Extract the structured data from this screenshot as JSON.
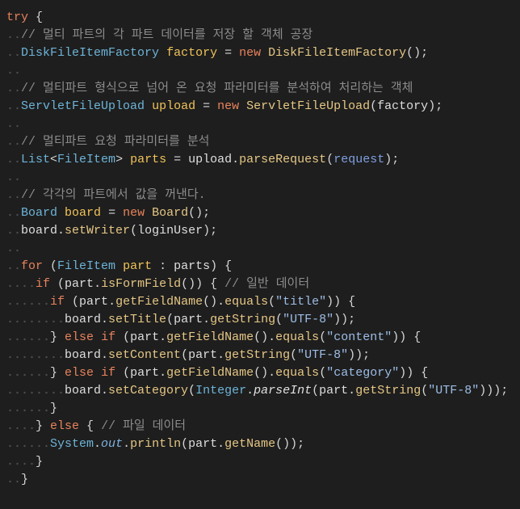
{
  "theme": {
    "background": "#1e1e1e",
    "punct": "#d6d6d6",
    "keyword": "#e8835c",
    "comment": "#8c8c8c",
    "type": "#6db4d8",
    "declaration": "#f0c35a",
    "method": "#e6c785",
    "string": "#9dbde6",
    "parameter": "#7f9fdf",
    "variable": "#dedede",
    "field": "#7fb3e0",
    "static_method": "#e0e0e0",
    "whitespace": "#4c4c4c"
  },
  "lines": [
    {
      "tokens": [
        {
          "text": "try",
          "type": "keyword"
        },
        {
          "text": " {",
          "type": "punct"
        }
      ]
    },
    {
      "tokens": [
        {
          "text": "  ",
          "type": "whitespace"
        },
        {
          "text": "// 멀티 파트의 각 파트 데이터를 저장 할 객체 공장",
          "type": "comment"
        }
      ]
    },
    {
      "tokens": [
        {
          "text": "  ",
          "type": "whitespace"
        },
        {
          "text": "DiskFileItemFactory",
          "type": "type"
        },
        {
          "text": " ",
          "type": "punct"
        },
        {
          "text": "factory",
          "type": "declaration"
        },
        {
          "text": " = ",
          "type": "punct"
        },
        {
          "text": "new",
          "type": "keyword"
        },
        {
          "text": " ",
          "type": "punct"
        },
        {
          "text": "DiskFileItemFactory",
          "type": "method"
        },
        {
          "text": "();",
          "type": "punct"
        }
      ]
    },
    {
      "tokens": [
        {
          "text": "  ",
          "type": "whitespace"
        }
      ]
    },
    {
      "tokens": [
        {
          "text": "  ",
          "type": "whitespace"
        },
        {
          "text": "// 멀티파트 형식으로 넘어 온 요청 파라미터를 분석하여 처리하는 객체",
          "type": "comment"
        }
      ]
    },
    {
      "tokens": [
        {
          "text": "  ",
          "type": "whitespace"
        },
        {
          "text": "ServletFileUpload",
          "type": "type"
        },
        {
          "text": " ",
          "type": "punct"
        },
        {
          "text": "upload",
          "type": "declaration"
        },
        {
          "text": " = ",
          "type": "punct"
        },
        {
          "text": "new",
          "type": "keyword"
        },
        {
          "text": " ",
          "type": "punct"
        },
        {
          "text": "ServletFileUpload",
          "type": "method"
        },
        {
          "text": "(",
          "type": "punct"
        },
        {
          "text": "factory",
          "type": "variable"
        },
        {
          "text": ");",
          "type": "punct"
        }
      ]
    },
    {
      "tokens": [
        {
          "text": "  ",
          "type": "whitespace"
        }
      ]
    },
    {
      "tokens": [
        {
          "text": "  ",
          "type": "whitespace"
        },
        {
          "text": "// 멀티파트 요청 파라미터를 분석",
          "type": "comment"
        }
      ]
    },
    {
      "tokens": [
        {
          "text": "  ",
          "type": "whitespace"
        },
        {
          "text": "List",
          "type": "type"
        },
        {
          "text": "<",
          "type": "punct"
        },
        {
          "text": "FileItem",
          "type": "type"
        },
        {
          "text": ">",
          "type": "punct"
        },
        {
          "text": " ",
          "type": "punct"
        },
        {
          "text": "parts",
          "type": "declaration"
        },
        {
          "text": " = ",
          "type": "punct"
        },
        {
          "text": "upload",
          "type": "variable"
        },
        {
          "text": ".",
          "type": "punct"
        },
        {
          "text": "parseRequest",
          "type": "method"
        },
        {
          "text": "(",
          "type": "punct"
        },
        {
          "text": "request",
          "type": "parameter"
        },
        {
          "text": ");",
          "type": "punct"
        }
      ]
    },
    {
      "tokens": [
        {
          "text": "  ",
          "type": "whitespace"
        }
      ]
    },
    {
      "tokens": [
        {
          "text": "  ",
          "type": "whitespace"
        },
        {
          "text": "// 각각의 파트에서 값을 꺼낸다.",
          "type": "comment"
        }
      ]
    },
    {
      "tokens": [
        {
          "text": "  ",
          "type": "whitespace"
        },
        {
          "text": "Board",
          "type": "type"
        },
        {
          "text": " ",
          "type": "punct"
        },
        {
          "text": "board",
          "type": "declaration"
        },
        {
          "text": " = ",
          "type": "punct"
        },
        {
          "text": "new",
          "type": "keyword"
        },
        {
          "text": " ",
          "type": "punct"
        },
        {
          "text": "Board",
          "type": "method"
        },
        {
          "text": "();",
          "type": "punct"
        }
      ]
    },
    {
      "tokens": [
        {
          "text": "  ",
          "type": "whitespace"
        },
        {
          "text": "board",
          "type": "variable"
        },
        {
          "text": ".",
          "type": "punct"
        },
        {
          "text": "setWriter",
          "type": "method"
        },
        {
          "text": "(",
          "type": "punct"
        },
        {
          "text": "loginUser",
          "type": "variable"
        },
        {
          "text": ");",
          "type": "punct"
        }
      ]
    },
    {
      "tokens": [
        {
          "text": "  ",
          "type": "whitespace"
        }
      ]
    },
    {
      "tokens": [
        {
          "text": "  ",
          "type": "whitespace"
        },
        {
          "text": "for",
          "type": "keyword"
        },
        {
          "text": " (",
          "type": "punct"
        },
        {
          "text": "FileItem",
          "type": "type"
        },
        {
          "text": " ",
          "type": "punct"
        },
        {
          "text": "part",
          "type": "declaration"
        },
        {
          "text": " : ",
          "type": "punct"
        },
        {
          "text": "parts",
          "type": "variable"
        },
        {
          "text": ") {",
          "type": "punct"
        }
      ]
    },
    {
      "tokens": [
        {
          "text": "    ",
          "type": "whitespace"
        },
        {
          "text": "if",
          "type": "keyword"
        },
        {
          "text": " (",
          "type": "punct"
        },
        {
          "text": "part",
          "type": "variable"
        },
        {
          "text": ".",
          "type": "punct"
        },
        {
          "text": "isFormField",
          "type": "method"
        },
        {
          "text": "()) { ",
          "type": "punct"
        },
        {
          "text": "// 일반 데이터",
          "type": "comment"
        }
      ]
    },
    {
      "tokens": [
        {
          "text": "      ",
          "type": "whitespace"
        },
        {
          "text": "if",
          "type": "keyword"
        },
        {
          "text": " (",
          "type": "punct"
        },
        {
          "text": "part",
          "type": "variable"
        },
        {
          "text": ".",
          "type": "punct"
        },
        {
          "text": "getFieldName",
          "type": "method"
        },
        {
          "text": "().",
          "type": "punct"
        },
        {
          "text": "equals",
          "type": "method"
        },
        {
          "text": "(",
          "type": "punct"
        },
        {
          "text": "\"title\"",
          "type": "string"
        },
        {
          "text": ")) {",
          "type": "punct"
        }
      ]
    },
    {
      "tokens": [
        {
          "text": "        ",
          "type": "whitespace"
        },
        {
          "text": "board",
          "type": "variable"
        },
        {
          "text": ".",
          "type": "punct"
        },
        {
          "text": "setTitle",
          "type": "method"
        },
        {
          "text": "(",
          "type": "punct"
        },
        {
          "text": "part",
          "type": "variable"
        },
        {
          "text": ".",
          "type": "punct"
        },
        {
          "text": "getString",
          "type": "method"
        },
        {
          "text": "(",
          "type": "punct"
        },
        {
          "text": "\"UTF-8\"",
          "type": "string"
        },
        {
          "text": "));",
          "type": "punct"
        }
      ]
    },
    {
      "tokens": [
        {
          "text": "      ",
          "type": "whitespace"
        },
        {
          "text": "} ",
          "type": "punct"
        },
        {
          "text": "else",
          "type": "keyword"
        },
        {
          "text": " ",
          "type": "punct"
        },
        {
          "text": "if",
          "type": "keyword"
        },
        {
          "text": " (",
          "type": "punct"
        },
        {
          "text": "part",
          "type": "variable"
        },
        {
          "text": ".",
          "type": "punct"
        },
        {
          "text": "getFieldName",
          "type": "method"
        },
        {
          "text": "().",
          "type": "punct"
        },
        {
          "text": "equals",
          "type": "method"
        },
        {
          "text": "(",
          "type": "punct"
        },
        {
          "text": "\"content\"",
          "type": "string"
        },
        {
          "text": ")) {",
          "type": "punct"
        }
      ]
    },
    {
      "tokens": [
        {
          "text": "        ",
          "type": "whitespace"
        },
        {
          "text": "board",
          "type": "variable"
        },
        {
          "text": ".",
          "type": "punct"
        },
        {
          "text": "setContent",
          "type": "method"
        },
        {
          "text": "(",
          "type": "punct"
        },
        {
          "text": "part",
          "type": "variable"
        },
        {
          "text": ".",
          "type": "punct"
        },
        {
          "text": "getString",
          "type": "method"
        },
        {
          "text": "(",
          "type": "punct"
        },
        {
          "text": "\"UTF-8\"",
          "type": "string"
        },
        {
          "text": "));",
          "type": "punct"
        }
      ]
    },
    {
      "tokens": [
        {
          "text": "      ",
          "type": "whitespace"
        },
        {
          "text": "} ",
          "type": "punct"
        },
        {
          "text": "else",
          "type": "keyword"
        },
        {
          "text": " ",
          "type": "punct"
        },
        {
          "text": "if",
          "type": "keyword"
        },
        {
          "text": " (",
          "type": "punct"
        },
        {
          "text": "part",
          "type": "variable"
        },
        {
          "text": ".",
          "type": "punct"
        },
        {
          "text": "getFieldName",
          "type": "method"
        },
        {
          "text": "().",
          "type": "punct"
        },
        {
          "text": "equals",
          "type": "method"
        },
        {
          "text": "(",
          "type": "punct"
        },
        {
          "text": "\"category\"",
          "type": "string"
        },
        {
          "text": ")) {",
          "type": "punct"
        }
      ]
    },
    {
      "tokens": [
        {
          "text": "        ",
          "type": "whitespace"
        },
        {
          "text": "board",
          "type": "variable"
        },
        {
          "text": ".",
          "type": "punct"
        },
        {
          "text": "setCategory",
          "type": "method"
        },
        {
          "text": "(",
          "type": "punct"
        },
        {
          "text": "Integer",
          "type": "type"
        },
        {
          "text": ".",
          "type": "punct"
        },
        {
          "text": "parseInt",
          "type": "static-method"
        },
        {
          "text": "(",
          "type": "punct"
        },
        {
          "text": "part",
          "type": "variable"
        },
        {
          "text": ".",
          "type": "punct"
        },
        {
          "text": "getString",
          "type": "method"
        },
        {
          "text": "(",
          "type": "punct"
        },
        {
          "text": "\"UTF-8\"",
          "type": "string"
        },
        {
          "text": ")));",
          "type": "punct"
        }
      ]
    },
    {
      "tokens": [
        {
          "text": "      ",
          "type": "whitespace"
        },
        {
          "text": "}",
          "type": "punct"
        }
      ]
    },
    {
      "tokens": [
        {
          "text": "    ",
          "type": "whitespace"
        },
        {
          "text": "} ",
          "type": "punct"
        },
        {
          "text": "else",
          "type": "keyword"
        },
        {
          "text": " { ",
          "type": "punct"
        },
        {
          "text": "// 파일 데이터",
          "type": "comment"
        }
      ]
    },
    {
      "tokens": [
        {
          "text": "      ",
          "type": "whitespace"
        },
        {
          "text": "System",
          "type": "type"
        },
        {
          "text": ".",
          "type": "punct"
        },
        {
          "text": "out",
          "type": "field"
        },
        {
          "text": ".",
          "type": "punct"
        },
        {
          "text": "println",
          "type": "method"
        },
        {
          "text": "(",
          "type": "punct"
        },
        {
          "text": "part",
          "type": "variable"
        },
        {
          "text": ".",
          "type": "punct"
        },
        {
          "text": "getName",
          "type": "method"
        },
        {
          "text": "());",
          "type": "punct"
        }
      ]
    },
    {
      "tokens": [
        {
          "text": "    ",
          "type": "whitespace"
        },
        {
          "text": "}",
          "type": "punct"
        }
      ]
    },
    {
      "tokens": [
        {
          "text": "  ",
          "type": "whitespace"
        },
        {
          "text": "}",
          "type": "punct"
        }
      ]
    }
  ]
}
